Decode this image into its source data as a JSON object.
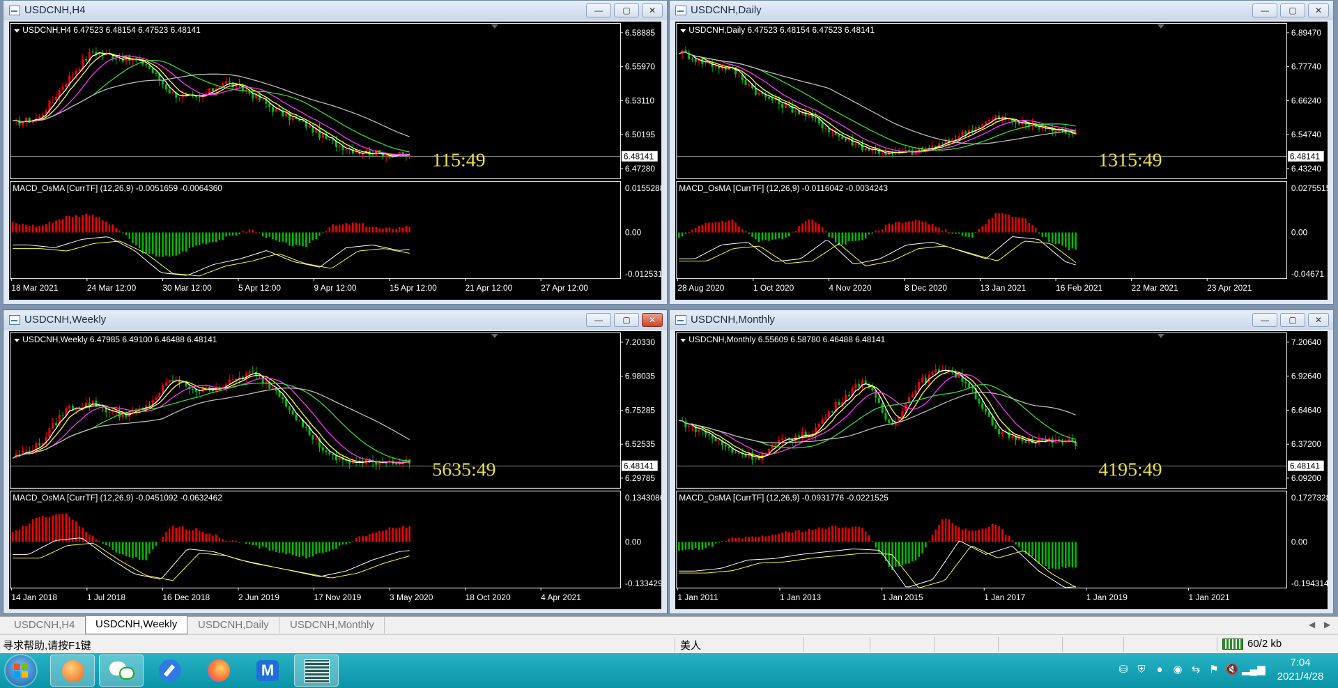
{
  "windows": [
    {
      "title": "USDCNH,H4",
      "header": "USDCNH,H4  6.47523 6.48154 6.47523 6.48141",
      "prices": [
        "6.58885",
        "6.55970",
        "6.53110",
        "6.50195",
        "6.47280"
      ],
      "price_current": "6.48141",
      "countdown": "115:49",
      "macd_header": "MACD_OsMA [CurrTF] (12,26,9) -0.0051659 -0.0064360",
      "macd_levels": [
        "0.0155288",
        "0.00",
        "-0.0125312"
      ],
      "dates": [
        "18 Mar 2021",
        "24 Mar 12:00",
        "30 Mar 12:00",
        "5 Apr 12:00",
        "9 Apr 12:00",
        "15 Apr 12:00",
        "21 Apr 12:00",
        "27 Apr 12:00"
      ]
    },
    {
      "title": "USDCNH,Daily",
      "header": "USDCNH,Daily  6.47523 6.48154 6.47523 6.48141",
      "prices": [
        "6.89470",
        "6.77740",
        "6.66240",
        "6.54740",
        "6.43240"
      ],
      "price_current": "6.48141",
      "countdown": "1315:49",
      "macd_header": "MACD_OsMA [CurrTF] (12,26,9) -0.0116042 -0.0034243",
      "macd_levels": [
        "0.0275515",
        "0.00",
        "-0.04671"
      ],
      "dates": [
        "28 Aug 2020",
        "1 Oct 2020",
        "4 Nov 2020",
        "8 Dec 2020",
        "13 Jan 2021",
        "16 Feb 2021",
        "22 Mar 2021",
        "23 Apr 2021"
      ]
    },
    {
      "title": "USDCNH,Weekly",
      "header": "USDCNH,Weekly  6.47985 6.49100 6.46488 6.48141",
      "prices": [
        "7.20330",
        "6.98035",
        "6.75285",
        "6.52535",
        "6.29785"
      ],
      "price_current": "6.48141",
      "countdown": "5635:49",
      "macd_header": "MACD_OsMA [CurrTF] (12,26,9) -0.0451092 -0.0632462",
      "macd_levels": [
        "0.1343086",
        "0.00",
        "-0.1334299"
      ],
      "dates": [
        "14 Jan 2018",
        "1 Jul 2018",
        "16 Dec 2018",
        "2 Jun 2019",
        "17 Nov 2019",
        "3 May 2020",
        "18 Oct 2020",
        "4 Apr 2021"
      ]
    },
    {
      "title": "USDCNH,Monthly",
      "header": "USDCNH,Monthly  6.55609 6.58780 6.46488 6.48141",
      "prices": [
        "7.20640",
        "6.92640",
        "6.64640",
        "6.37200",
        "6.09200"
      ],
      "price_current": "6.48141",
      "countdown": "4195:49",
      "macd_header": "MACD_OsMA [CurrTF] (12,26,9) -0.0931776 -0.0221525",
      "macd_levels": [
        "0.1727328",
        "0.00",
        "-0.194314"
      ],
      "dates": [
        "1 Jan 2011",
        "1 Jan 2013",
        "1 Jan 2015",
        "1 Jan 2017",
        "1 Jan 2019",
        "1 Jan 2021"
      ]
    }
  ],
  "tabs": [
    "USDCNH,H4",
    "USDCNH,Weekly",
    "USDCNH,Daily",
    "USDCNH,Monthly"
  ],
  "selected_tab": "USDCNH,Weekly",
  "status": {
    "help": "寻求帮助,请按F1键",
    "profile": "美人",
    "traffic": "60/2 kb"
  },
  "clock": {
    "time": "7:04",
    "date": "2021/4/28"
  },
  "colors": {
    "bull": "#ff0000",
    "bear": "#00c000",
    "ma_white": "#ffffff",
    "ma_yellow": "#ffff33",
    "ma_magenta": "#ff33ff",
    "ma_green": "#33dd33",
    "ma_gray": "#bbbbbb",
    "countdown": "#e8e04a"
  },
  "taskbar_icons": [
    "start-orb",
    "app-orange",
    "wechat",
    "app-blue-pen",
    "firefox",
    "app-blue-m",
    "app-qr"
  ]
}
